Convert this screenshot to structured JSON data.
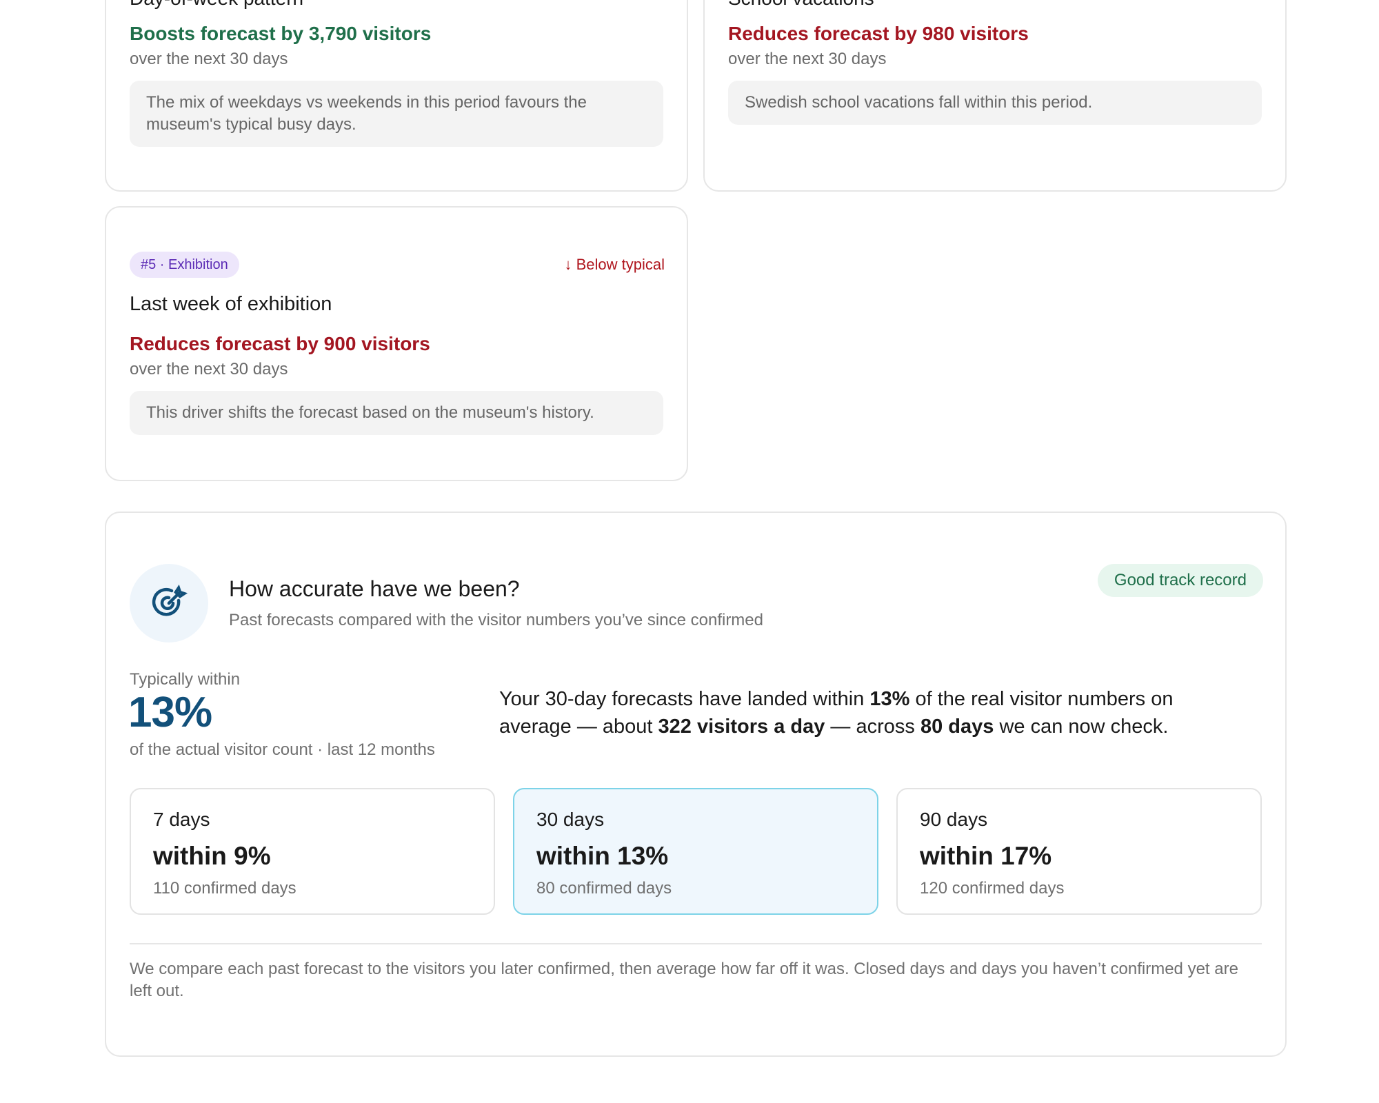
{
  "drivers": [
    {
      "title": "Day-of-week pattern",
      "effect": "Boosts forecast by 3,790 visitors",
      "direction": "up",
      "horizon": "over the next 30 days",
      "note": "The mix of weekdays vs weekends in this period favours the museum's typical busy days."
    },
    {
      "title": "School vacations",
      "effect": "Reduces forecast by 980 visitors",
      "direction": "down",
      "horizon": "over the next 30 days",
      "note": "Swedish school vacations fall within this period."
    },
    {
      "rank_label": "#5 · Exhibition",
      "trend": "↓ Below typical",
      "title": "Last week of exhibition",
      "effect": "Reduces forecast by 900 visitors",
      "direction": "down",
      "horizon": "over the next 30 days",
      "note": "This driver shifts the forecast based on the museum's history."
    }
  ],
  "accuracy": {
    "icon": "target-icon",
    "title": "How accurate have we been?",
    "subtitle": "Past forecasts compared with the visitor numbers you’ve since confirmed",
    "badge": "Good track record",
    "typical_label": "Typically within",
    "typical_value": "13%",
    "typical_caption": "of the actual visitor count · last 12 months",
    "summary": {
      "p1": "Your 30-day forecasts have landed within ",
      "b1": "13%",
      "p2": " of the real visitor numbers on average — about ",
      "b2": "322 visitors a day",
      "p3": " — across ",
      "b3": "80 days",
      "p4": " we can now check."
    },
    "windows": [
      {
        "label": "7 days",
        "value": "within 9%",
        "count": "110 confirmed days",
        "selected": false
      },
      {
        "label": "30 days",
        "value": "within 13%",
        "count": "80 confirmed days",
        "selected": true
      },
      {
        "label": "90 days",
        "value": "within 17%",
        "count": "120 confirmed days",
        "selected": false
      }
    ],
    "footnote": "We compare each past forecast to the visitors you later confirmed, then average how far off it was. Closed days and days you haven’t confirmed yet are left out."
  },
  "colors": {
    "boost": "#1f6f4a",
    "reduce": "#a31621",
    "accent": "#12507a",
    "exhibition_pill": "#ede6fb",
    "selected_window_border": "#7dd3e8"
  }
}
